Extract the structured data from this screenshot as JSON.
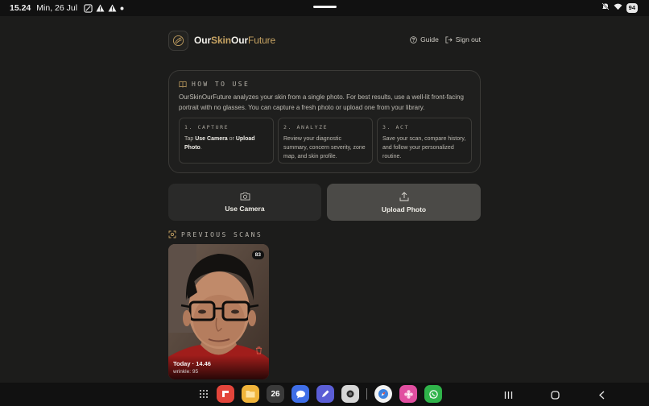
{
  "status_bar": {
    "time": "15.24",
    "date": "Min, 26 Jul",
    "battery": "94"
  },
  "brand": {
    "part1": "Our",
    "part2": "Skin",
    "part3": "Our",
    "part4": "Future"
  },
  "nav": {
    "guide": "Guide",
    "sign_out": "Sign out"
  },
  "how_to": {
    "title": "HOW TO USE",
    "description": "OurSkinOurFuture analyzes your skin from a single photo. For best results, use a well-lit front-facing portrait with no glasses. You can capture a fresh photo or upload one from your library.",
    "steps": [
      {
        "title": "1. CAPTURE",
        "text_prefix": "Tap ",
        "bold1": "Use Camera",
        "text_mid": " or ",
        "bold2": "Upload Photo",
        "text_suffix": "."
      },
      {
        "title": "2. ANALYZE",
        "body": "Review your diagnostic summary, concern severity, zone map, and skin profile."
      },
      {
        "title": "3. ACT",
        "body": "Save your scan, compare history, and follow your personalized routine."
      }
    ]
  },
  "actions": {
    "camera": "Use Camera",
    "upload": "Upload Photo"
  },
  "previous_scans": {
    "title": "PREVIOUS SCANS",
    "items": [
      {
        "score": "83",
        "date": "Today · 14.46",
        "detail": "wrinkle: 95"
      }
    ]
  },
  "dock": {
    "calendar_day": "26"
  },
  "colors": {
    "background": "#1c1c1b",
    "accent": "#c8a463",
    "upload_button": "#4b4a47",
    "camera_button": "#2a2a29"
  }
}
